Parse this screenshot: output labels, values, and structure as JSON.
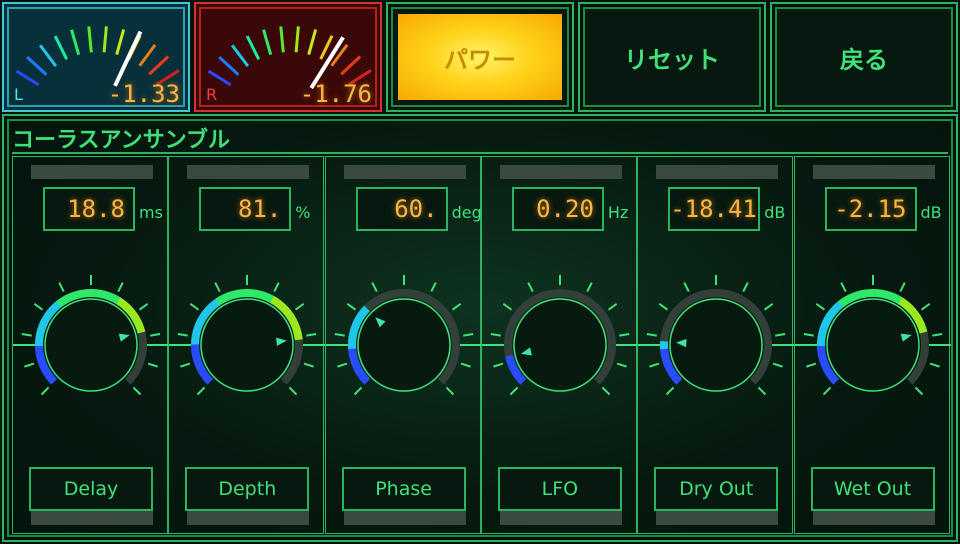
{
  "meters": {
    "left": {
      "channel": "L",
      "value": "-1.33"
    },
    "right": {
      "channel": "R",
      "value": "-1.76"
    }
  },
  "buttons": {
    "power": "パワー",
    "reset": "リセット",
    "back": "戻る"
  },
  "panel": {
    "title": "コーラスアンサンブル",
    "controls": [
      {
        "name": "Delay",
        "value": "18.8",
        "unit": "ms",
        "level": 0.78
      },
      {
        "name": "Depth",
        "value": "81.",
        "unit": "%",
        "level": 0.81
      },
      {
        "name": "Phase",
        "value": "60.",
        "unit": "deg",
        "level": 0.33
      },
      {
        "name": "LFO",
        "value": "0.20",
        "unit": "Hz",
        "level": 0.12
      },
      {
        "name": "Dry Out",
        "value": "-18.41",
        "unit": "dB",
        "level": 0.18
      },
      {
        "name": "Wet Out",
        "value": "-2.15",
        "unit": "dB",
        "level": 0.78
      }
    ]
  },
  "colors": {
    "accent": "#3fe27a",
    "readout": "#f7b64a",
    "power": "#ffd21a",
    "meter_left": "#3ec8d8",
    "meter_right": "#d83030"
  }
}
